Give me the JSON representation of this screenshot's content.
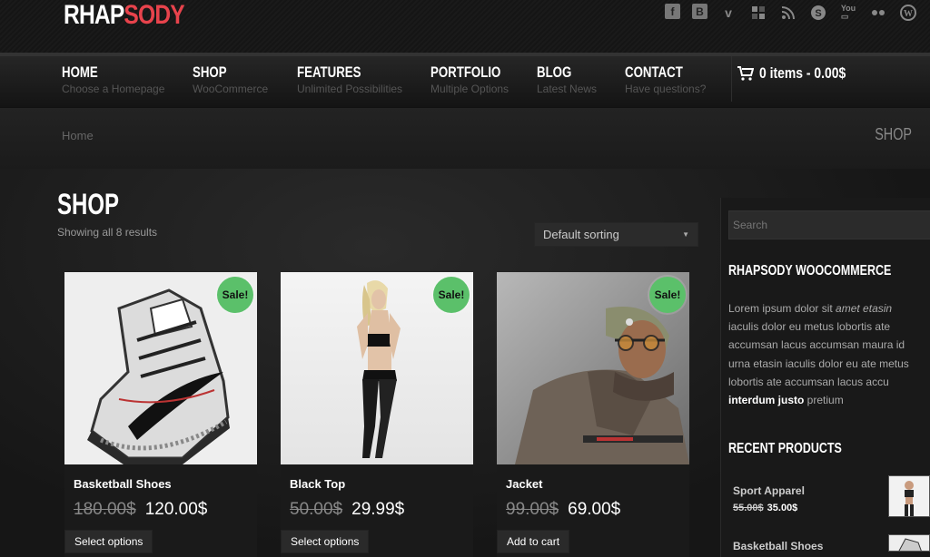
{
  "logo": {
    "part1": "RHAP",
    "part2": "SODY"
  },
  "nav": [
    {
      "label": "HOME",
      "sub": "Choose a Homepage"
    },
    {
      "label": "SHOP",
      "sub": "WooCommerce"
    },
    {
      "label": "FEATURES",
      "sub": "Unlimited Possibilities"
    },
    {
      "label": "PORTFOLIO",
      "sub": "Multiple Options"
    },
    {
      "label": "BLOG",
      "sub": "Latest News"
    },
    {
      "label": "CONTACT",
      "sub": "Have questions?"
    }
  ],
  "cart": {
    "label": "0 items - 0.00$"
  },
  "breadcrumb": {
    "home": "Home",
    "title": "SHOP"
  },
  "shop": {
    "title": "SHOP",
    "result_count": "Showing all 8 results",
    "sort_selected": "Default sorting"
  },
  "products": [
    {
      "name": "Basketball Shoes",
      "old_price": "180.00$",
      "price": "120.00$",
      "badge": "Sale!",
      "button": "Select options"
    },
    {
      "name": "Black Top",
      "old_price": "50.00$",
      "price": "29.99$",
      "badge": "Sale!",
      "button": "Select options"
    },
    {
      "name": "Jacket",
      "old_price": "99.00$",
      "price": "69.00$",
      "badge": "Sale!",
      "button": "Add to cart"
    }
  ],
  "sidebar": {
    "search_placeholder": "Search",
    "widget_title": "RHAPSODY WOOCOMMERCE",
    "text_1": "Lorem ipsum dolor sit ",
    "text_italic": "amet etasin",
    "text_2": " iaculis dolor eu metus lobortis ate accumsan lacus accumsan maura id urna etasin iaculis dolor eu ate metus lobortis ate accumsan lacus accu ",
    "text_bold": "interdum justo",
    "text_3": " pretium",
    "recent_title": "RECENT PRODUCTS",
    "recent": [
      {
        "name": "Sport Apparel",
        "old_price": "55.00$",
        "price": "35.00$"
      },
      {
        "name": "Basketball Shoes"
      }
    ]
  },
  "colors": {
    "accent": "#e8434c",
    "sale_badge": "#5bc06a",
    "background": "#1c1c1c"
  },
  "icons": [
    "facebook-icon",
    "blogger-icon",
    "vimeo-icon",
    "delicious-icon",
    "rss-icon",
    "skype-icon",
    "youtube-icon",
    "flickr-icon",
    "wordpress-icon",
    "cart-icon"
  ]
}
